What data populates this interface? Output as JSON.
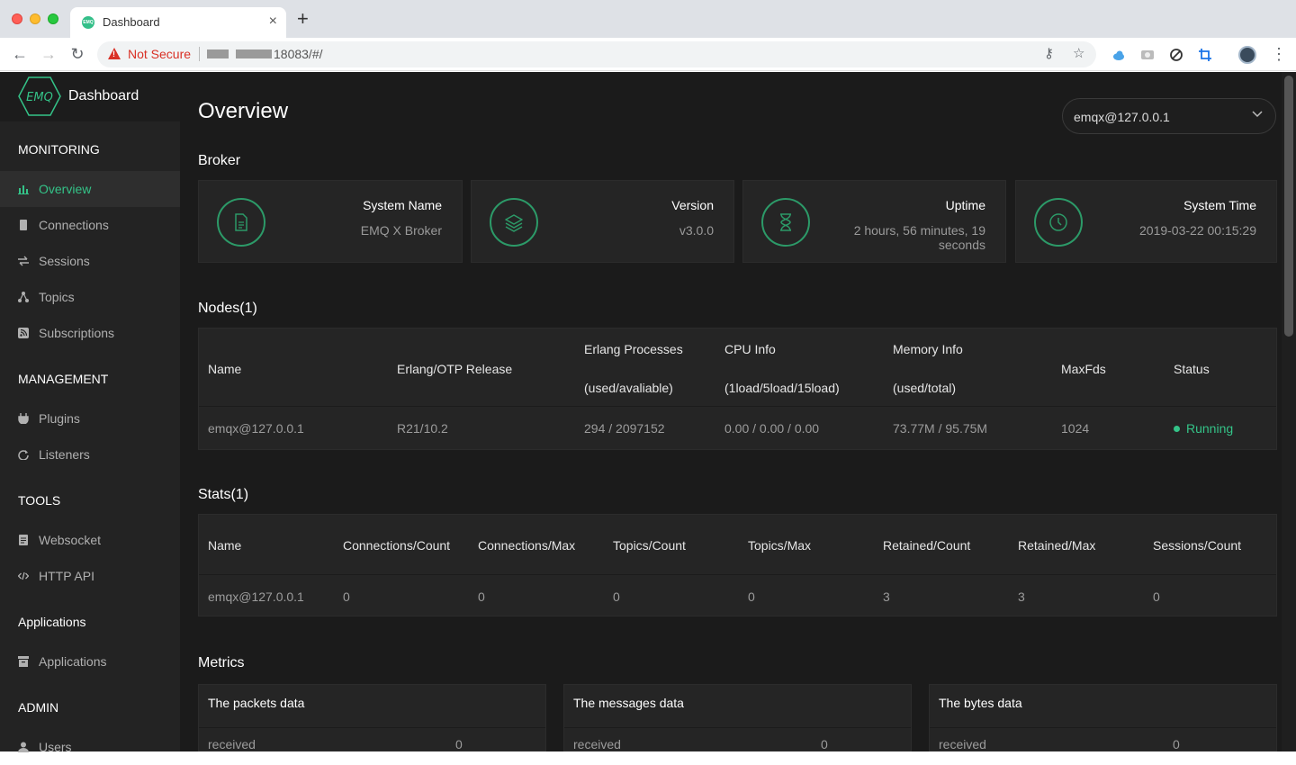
{
  "browser": {
    "tab_title": "Dashboard",
    "new_tab_label": "+",
    "close_tab_label": "×",
    "security_label": "Not Secure",
    "url_suffix": "18083/#/"
  },
  "sidebar": {
    "brand_logo_text": "EMQ",
    "brand_title": "Dashboard",
    "sections": {
      "monitoring": "MONITORING",
      "management": "MANAGEMENT",
      "tools": "TOOLS",
      "applications": "Applications",
      "admin": "ADMIN"
    },
    "items": {
      "overview": "Overview",
      "connections": "Connections",
      "sessions": "Sessions",
      "topics": "Topics",
      "subscriptions": "Subscriptions",
      "plugins": "Plugins",
      "listeners": "Listeners",
      "websocket": "Websocket",
      "http_api": "HTTP API",
      "applications": "Applications",
      "users": "Users"
    }
  },
  "main": {
    "title": "Overview",
    "node_selector": "emqx@127.0.0.1",
    "broker": {
      "heading": "Broker",
      "cards": [
        {
          "label": "System Name",
          "value": "EMQ X Broker",
          "icon": "document-icon"
        },
        {
          "label": "Version",
          "value": "v3.0.0",
          "icon": "layers-icon"
        },
        {
          "label": "Uptime",
          "value_line1": "2 hours, 56 minutes, 19",
          "value_line2": "seconds",
          "icon": "hourglass-icon"
        },
        {
          "label": "System Time",
          "value": "2019-03-22 00:15:29",
          "icon": "clock-icon"
        }
      ]
    },
    "nodes": {
      "heading": "Nodes(1)",
      "headers": {
        "name": "Name",
        "otp": "Erlang/OTP Release",
        "processes_1": "Erlang Processes",
        "processes_2": "(used/avaliable)",
        "cpu_1": "CPU Info",
        "cpu_2": "(1load/5load/15load)",
        "memory_1": "Memory Info",
        "memory_2": "(used/total)",
        "maxfds": "MaxFds",
        "status": "Status"
      },
      "row": {
        "name": "emqx@127.0.0.1",
        "otp": "R21/10.2",
        "processes": "294 / 2097152",
        "cpu": "0.00 / 0.00 / 0.00",
        "memory": "73.77M / 95.75M",
        "maxfds": "1024",
        "status": "Running"
      }
    },
    "stats": {
      "heading": "Stats(1)",
      "headers": [
        "Name",
        "Connections/Count",
        "Connections/Max",
        "Topics/Count",
        "Topics/Max",
        "Retained/Count",
        "Retained/Max",
        "Sessions/Count"
      ],
      "row": [
        "emqx@127.0.0.1",
        "0",
        "0",
        "0",
        "0",
        "3",
        "3",
        "0"
      ]
    },
    "metrics": {
      "heading": "Metrics",
      "cards": [
        {
          "title": "The packets data",
          "label": "received",
          "value": "0"
        },
        {
          "title": "The messages data",
          "label": "received",
          "value": "0"
        },
        {
          "title": "The bytes data",
          "label": "received",
          "value": "0"
        }
      ]
    }
  },
  "colors": {
    "accent": "#34c388",
    "sidebar_bg": "#232323",
    "content_bg": "#1b1b1b",
    "card_bg": "#252525",
    "warning": "#d93025"
  }
}
